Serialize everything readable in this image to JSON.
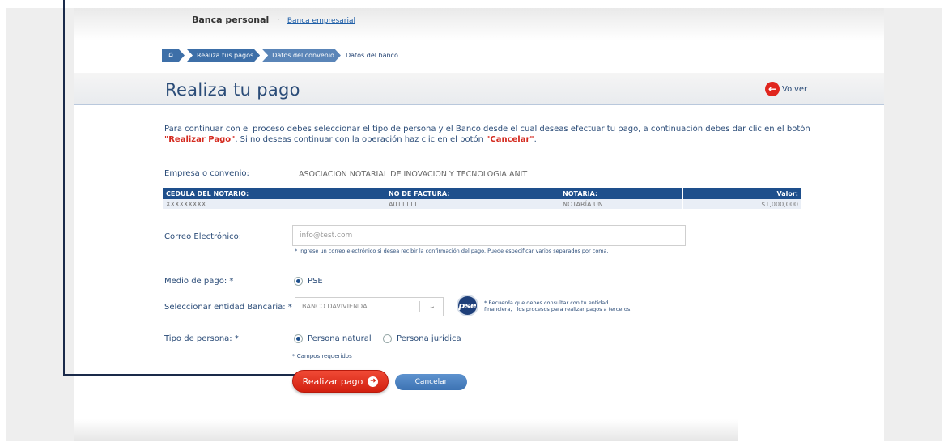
{
  "top_links": {
    "personal": "Banca personal",
    "separator": "·",
    "empresarial": "Banca empresarial"
  },
  "breadcrumb": {
    "home_icon": "home-icon",
    "items": [
      "Realiza tus pagos",
      "Datos del convenio"
    ],
    "current": "Datos del banco"
  },
  "page": {
    "title": "Realiza tu pago",
    "back_label": "Volver",
    "back_icon": "arrow-left-circle-icon"
  },
  "instructions": {
    "part1": "Para continuar con el proceso debes seleccionar el tipo de persona y el Banco desde el cual deseas efectuar tu pago, a continuación debes dar clic en el botón ",
    "highlight1": "\"Realizar Pago\"",
    "part2": ". Si no deseas continuar con la operación haz clic en el botón ",
    "highlight2": "\"Cancelar\"",
    "part3": "."
  },
  "company": {
    "label": "Empresa o convenio:",
    "value": "ASOCIACION NOTARIAL DE INOVACION Y TECNOLOGIA ANIT"
  },
  "table": {
    "headers": [
      "CEDULA DEL NOTARIO:",
      "NO DE FACTURA:",
      "NOTARIA:",
      "Valor:"
    ],
    "row": [
      "XXXXXXXXX",
      "A011111",
      "NOTARÍA UN",
      "$1,000,000"
    ]
  },
  "email": {
    "label": "Correo Electrónico:",
    "placeholder": "info@test.com",
    "hint": "* Ingrese un correo electrónico si desea recibir la confirmación del pago. Puede especificar varios separados por coma."
  },
  "payment_method": {
    "label": "Medio de pago: *",
    "option": "PSE"
  },
  "bank": {
    "label": "Seleccionar entidad Bancaria: *",
    "selected": "BANCO DAVIVIENDA",
    "logo_text": "pse",
    "note_line1": "* Recuerda que debes consultar con tu entidad",
    "note_line2": "financiera,   los procesos para realizar pagos a terceros."
  },
  "person_type": {
    "label": "Tipo de persona: *",
    "options": [
      "Persona natural",
      "Persona juridica"
    ]
  },
  "required_note": "* Campos requeridos",
  "buttons": {
    "pay": "Realizar pago",
    "cancel": "Cancelar"
  },
  "colors": {
    "brand_blue": "#1e4f8c",
    "title_blue": "#2b4c78",
    "accent_red": "#d2200f"
  }
}
